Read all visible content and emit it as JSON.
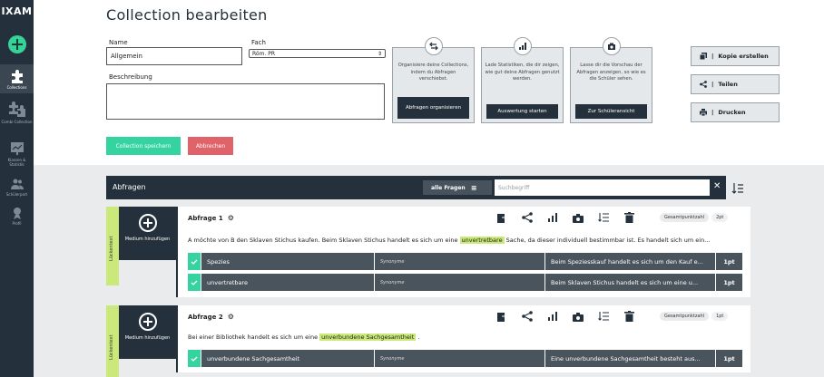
{
  "sidebar": {
    "logo": "IXAM",
    "items": [
      {
        "label": "Collections"
      },
      {
        "label": "Combi-Collection"
      },
      {
        "label": "Klassen & Statistik"
      },
      {
        "label": "Schülerport"
      },
      {
        "label": "Profil"
      }
    ]
  },
  "page": {
    "title": "Collection bearbeiten"
  },
  "form": {
    "name_label": "Name",
    "name_value": "Allgemein",
    "fach_label": "Fach",
    "fach_value": "Röm. PR",
    "desc_label": "Beschreibung",
    "save_label": "Collection speichern",
    "cancel_label": "Abbrechen"
  },
  "cards": [
    {
      "icon": "swap-icon",
      "text": "Organisiere deine Collections, indem du Abfragen verschiebst.",
      "button": "Abfragen organisieren"
    },
    {
      "icon": "bar-chart-icon",
      "text": "Lade Statistiken, die dir zeigen, wie gut deine Abfragen genutzt werden.",
      "button": "Auswertung starten"
    },
    {
      "icon": "camera-icon",
      "text": "Lasse dir die Vorschau der Abfragen anzeigen, so wie es die Schüler sehen.",
      "button": "Zur Schüleransicht"
    }
  ],
  "actions": [
    {
      "icon": "copy-icon",
      "label": "Kopie erstellen"
    },
    {
      "icon": "share-icon",
      "label": "Teilen"
    },
    {
      "icon": "print-icon",
      "label": "Drucken"
    }
  ],
  "abfragen": {
    "title": "Abfragen",
    "filter_label": "alle Fragen",
    "search_placeholder": "Suchbegriff"
  },
  "questions": [
    {
      "tag": "Lückentext",
      "medium": "Medium hinzufügen",
      "title": "Abfrage 1",
      "points_label": "Gesamtpunktzahl",
      "points": "2pt",
      "text_before": "A möchte von B den Sklaven Stichus kaufen. Beim Sklaven Stichus handelt es sich um eine",
      "highlight": "unvertretbare",
      "text_after": "Sache, da dieser individuell bestimmbar ist. Es handelt sich um ein...",
      "answers": [
        {
          "answer": "Spezies",
          "synonyms": "Synonyme",
          "explanation": "Beim Speziesskauf handelt es sich um den Kauf e...",
          "points": "1pt"
        },
        {
          "answer": "unvertretbare",
          "synonyms": "Synonyme",
          "explanation": "Beim Sklaven Stichus handelt es sich um eine u...",
          "points": "1pt"
        }
      ]
    },
    {
      "tag": "Lückentext",
      "medium": "Medium hinzufügen",
      "title": "Abfrage 2",
      "points_label": "Gesamtpunktzahl",
      "points": "1pt",
      "text_before": "Bei einer Bibliothek handelt es sich um eine",
      "highlight": "unverbundene Sachgesamtheit",
      "text_after": ".",
      "answers": [
        {
          "answer": "unverbundene Sachgesamtheit",
          "synonyms": "Synonyme",
          "explanation": "Eine unverbundene Sachgesamtheit besteht aus...",
          "points": "1pt"
        }
      ]
    }
  ]
}
